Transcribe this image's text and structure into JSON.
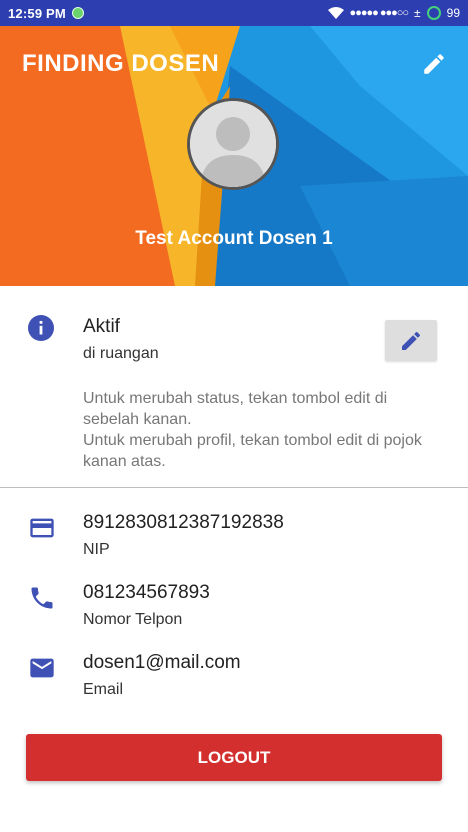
{
  "status_bar": {
    "time": "12:59 PM",
    "battery": "99",
    "icons": [
      "wifi-icon",
      "signal-icon",
      "battery-icon"
    ]
  },
  "header": {
    "app_title": "FINDING DOSEN",
    "user_name": "Test Account Dosen 1",
    "edit_icon": "pencil-icon"
  },
  "status": {
    "title": "Aktif",
    "location": "di ruangan",
    "hint_line_1": "Untuk merubah status, tekan tombol edit di sebelah kanan.",
    "hint_line_2": "Untuk merubah profil, tekan tombol edit di pojok kanan atas."
  },
  "details": [
    {
      "icon": "card-icon",
      "value": "8912830812387192838",
      "label": "NIP"
    },
    {
      "icon": "phone-icon",
      "value": "081234567893",
      "label": "Nomor Telpon"
    },
    {
      "icon": "mail-icon",
      "value": "dosen1@mail.com",
      "label": "Email"
    }
  ],
  "logout_label": "LOGOUT",
  "colors": {
    "status_bar": "#2d3fb0",
    "accent_icon": "#3f51b5",
    "logout": "#d32f2f"
  }
}
